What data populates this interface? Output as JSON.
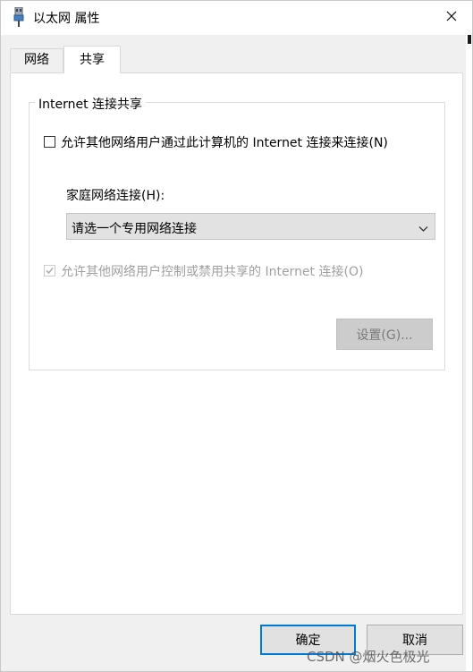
{
  "window": {
    "title": "以太网 属性",
    "icon": "network-adapter-icon"
  },
  "titlebar": {
    "close_icon": "close-icon"
  },
  "tabs": [
    {
      "label": "网络",
      "active": false
    },
    {
      "label": "共享",
      "active": true
    }
  ],
  "sharing": {
    "group_title": "Internet 连接共享",
    "allow_share_label": "允许其他网络用户通过此计算机的 Internet 连接来连接(N)",
    "allow_share_checked": false,
    "home_network_label": "家庭网络连接(H):",
    "home_network_selected": "请选一个专用网络连接",
    "allow_control_label": "允许其他网络用户控制或禁用共享的 Internet 连接(O)",
    "allow_control_checked": true,
    "allow_control_enabled": false,
    "settings_button": "设置(G)..."
  },
  "footer": {
    "ok_label": "确定",
    "cancel_label": "取消"
  },
  "watermark": "CSDN @烟火色极光"
}
